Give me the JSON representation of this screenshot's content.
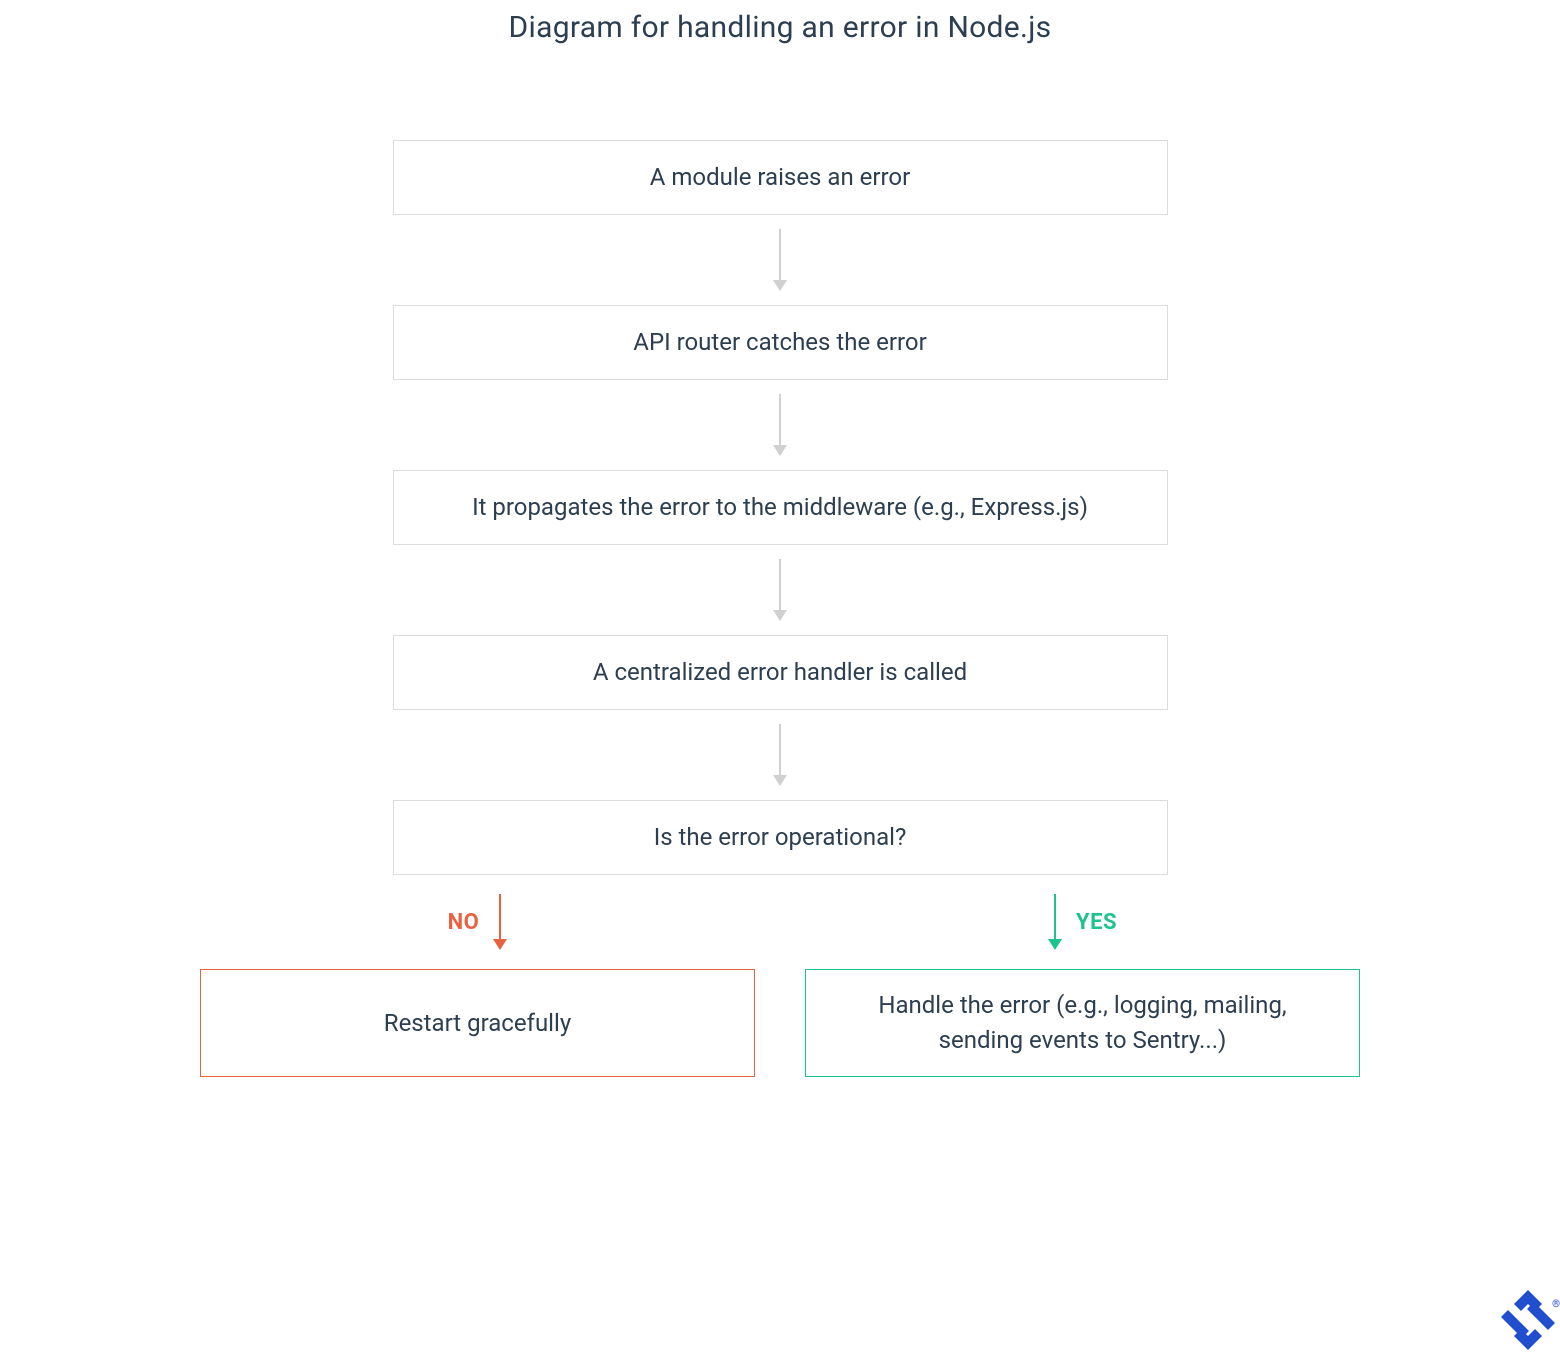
{
  "title": "Diagram for handling an error in Node.js",
  "nodes": {
    "step1": "A module raises an error",
    "step2": "API router catches the error",
    "step3": "It propagates the error to the middleware (e.g., Express.js)",
    "step4": "A centralized error handler is called",
    "decision": "Is the error operational?",
    "no_result": "Restart gracefully",
    "yes_result": "Handle the error (e.g., logging, mailing, sending events to Sentry...)"
  },
  "labels": {
    "no": "NO",
    "yes": "YES"
  },
  "colors": {
    "no": "#e8623f",
    "yes": "#1cc48a",
    "neutral_arrow": "#d0d0d0",
    "text": "#2c3e50",
    "brand": "#204ecf"
  }
}
